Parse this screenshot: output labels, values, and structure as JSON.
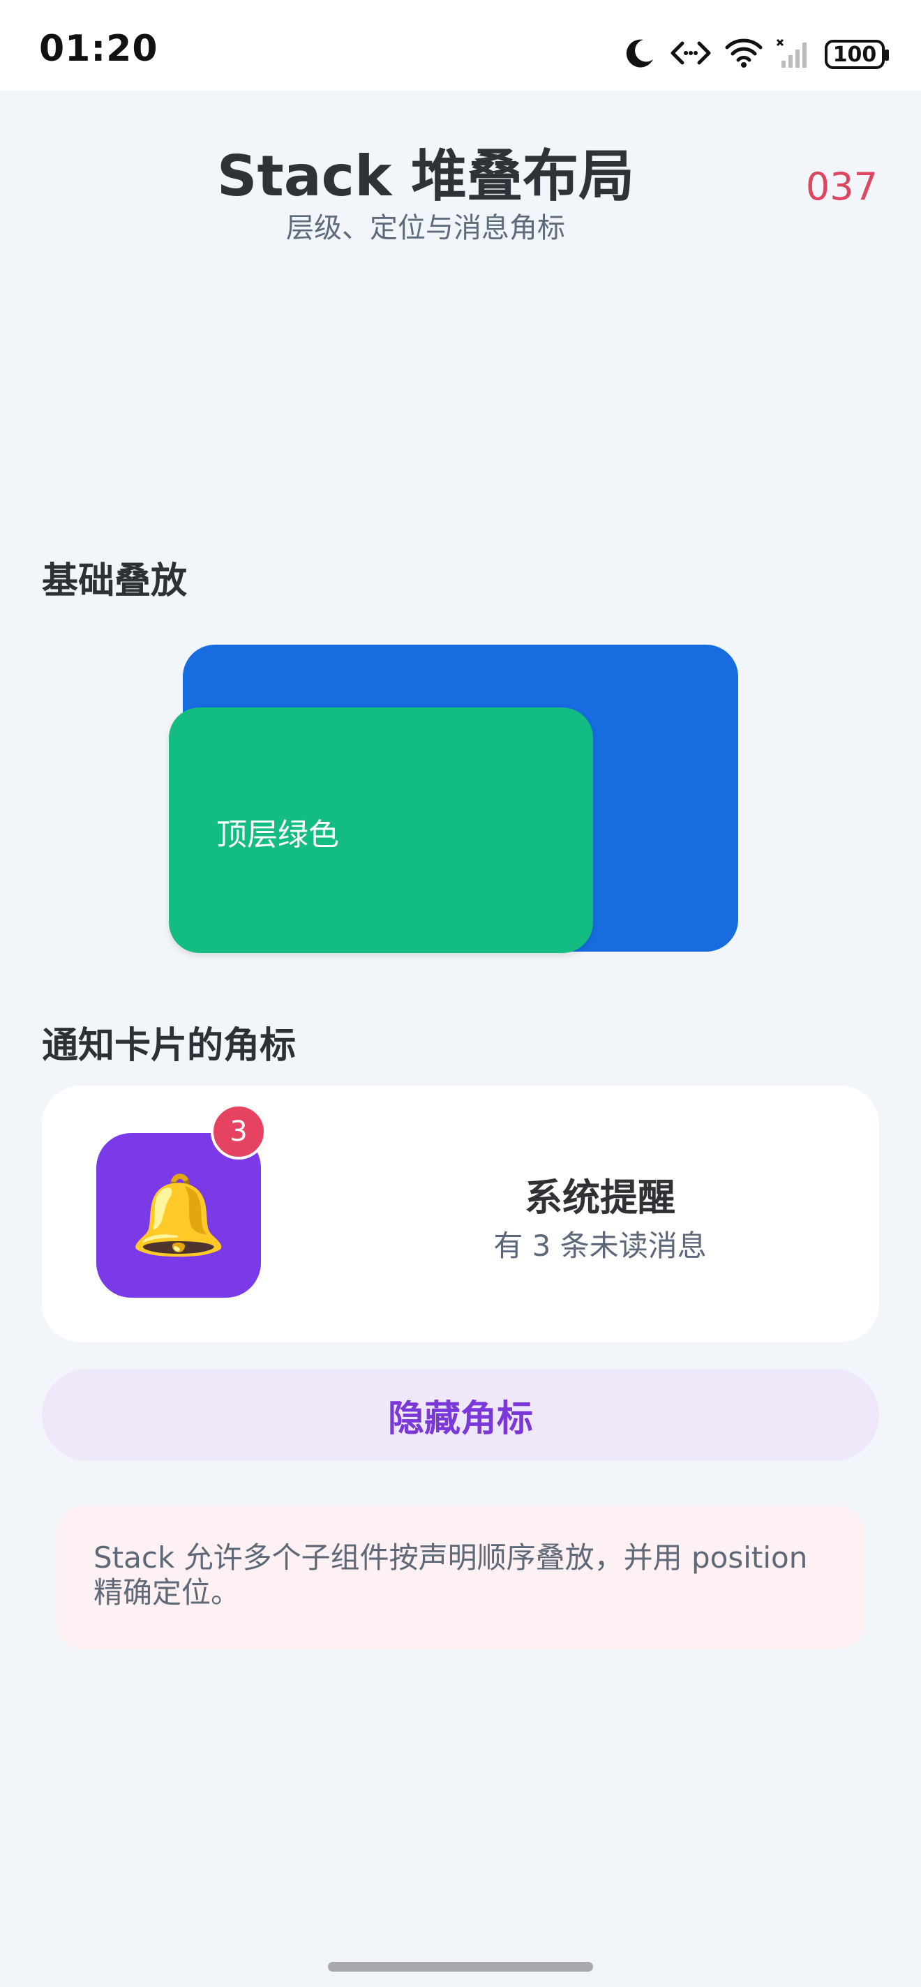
{
  "status_bar": {
    "time": "01:20",
    "battery": "100",
    "icons": [
      "moon-icon",
      "code-icon",
      "wifi-icon",
      "signal-icon",
      "battery-icon"
    ]
  },
  "header": {
    "title": "Stack 堆叠布局",
    "subtitle": "层级、定位与消息角标",
    "counter": "037"
  },
  "sections": {
    "basic_stack": {
      "title": "基础叠放",
      "top_layer_label": "顶层绿色",
      "colors": {
        "bottom": "#176ce0",
        "top": "#13bd82"
      }
    },
    "notification": {
      "title": "通知卡片的角标",
      "badge_count": "3",
      "card_title": "系统提醒",
      "card_subtitle": "有 3 条未读消息",
      "icon": "bell-icon",
      "icon_color": "#7a3ae8"
    }
  },
  "actions": {
    "hide_badge_label": "隐藏角标"
  },
  "info": {
    "text": "Stack 允许多个子组件按声明顺序叠放，并用 position 精确定位。"
  }
}
